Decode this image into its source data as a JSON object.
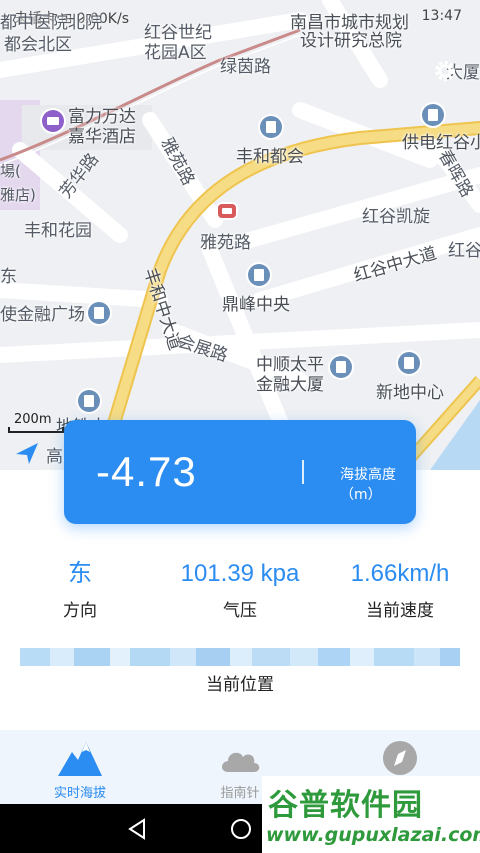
{
  "status_bar": {
    "left": "未插卡 ⊞ 0.00K/s",
    "time": "13:47"
  },
  "map": {
    "labels": [
      "都中医院北院",
      "都会北区",
      "红谷世纪",
      "花园A区",
      "南昌市城市规划",
      "设计研究总院",
      "绿茵路",
      "富力万达",
      "嘉华酒店",
      "丰和都会",
      "供电红谷小",
      "芳华路",
      "雅苑路",
      "红谷凯旋",
      "丰和花园",
      "红谷中大道",
      "鼎峰中央",
      "使金融广场",
      "丰和中大道",
      "会展路",
      "中顺太平",
      "金融大厦",
      "新地中心",
      "地铁大",
      "东",
      "場(",
      "雅店)",
      "大厦",
      "春晖路",
      "红谷",
      "高"
    ],
    "scale": "200m"
  },
  "altitude": {
    "value": "-4.73",
    "unit_label": "海拔高度（m）"
  },
  "stats": [
    {
      "value": "东",
      "label": "方向"
    },
    {
      "value": "101.39 kpa",
      "label": "气压"
    },
    {
      "value": "1.66km/h",
      "label": "当前速度"
    }
  ],
  "location": {
    "label": "当前位置"
  },
  "tabs": [
    {
      "label": "实时海拔",
      "icon": "mountain-icon"
    },
    {
      "label": "指南针",
      "icon": "cloud-icon"
    },
    {
      "label": "",
      "icon": "compass-icon"
    }
  ],
  "watermark": {
    "title": "谷普软件园",
    "url": "www.gupuxlazai.com"
  },
  "colors": {
    "accent": "#2b8cf1",
    "road": "#f4d36b",
    "watermark": "#2e9a3c"
  }
}
